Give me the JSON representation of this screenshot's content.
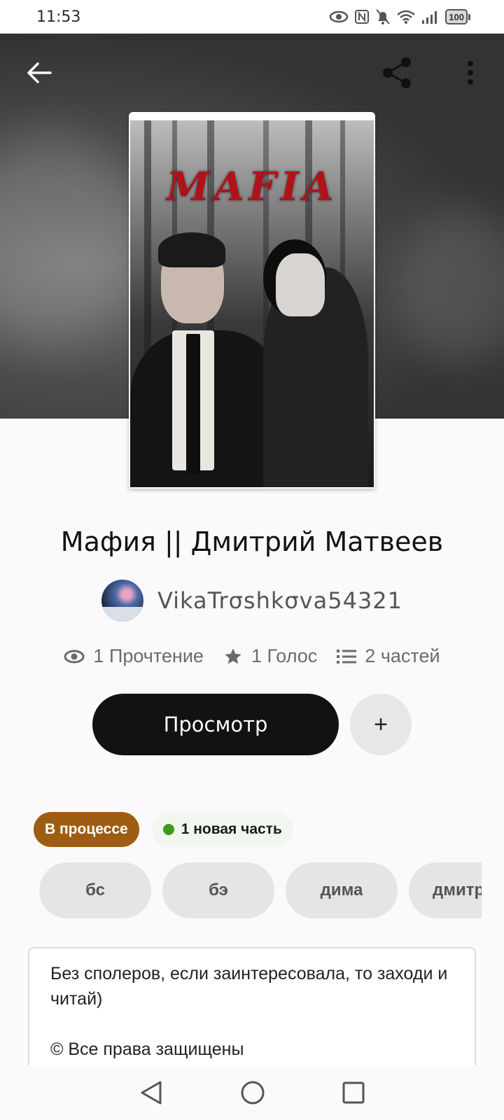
{
  "status_bar": {
    "time": "11:53",
    "battery": "100"
  },
  "header": {
    "back_icon": "arrow-left-icon",
    "share_icon": "share-icon",
    "menu_icon": "more-vertical-icon"
  },
  "cover": {
    "title_text": "MAFIA"
  },
  "book": {
    "title": "Мафия || Дмитрий Матвеев",
    "author": "VikaTrσshkσva54321"
  },
  "stats": {
    "reads": "1 Прочтение",
    "votes": "1 Голос",
    "parts": "2 частей"
  },
  "actions": {
    "read_label": "Просмотр",
    "add_label": "+"
  },
  "badges": {
    "status": "В процессе",
    "new_part": "1 новая часть",
    "new_part_color": "#3e9a1d",
    "status_color": "#9e5d12"
  },
  "tags": [
    "бс",
    "бэ",
    "дима",
    "дмитр"
  ],
  "description": {
    "line1": "Без сполеров, если заинтересовала, то заходи и читай)",
    "copyright": "© Все права защищены"
  }
}
